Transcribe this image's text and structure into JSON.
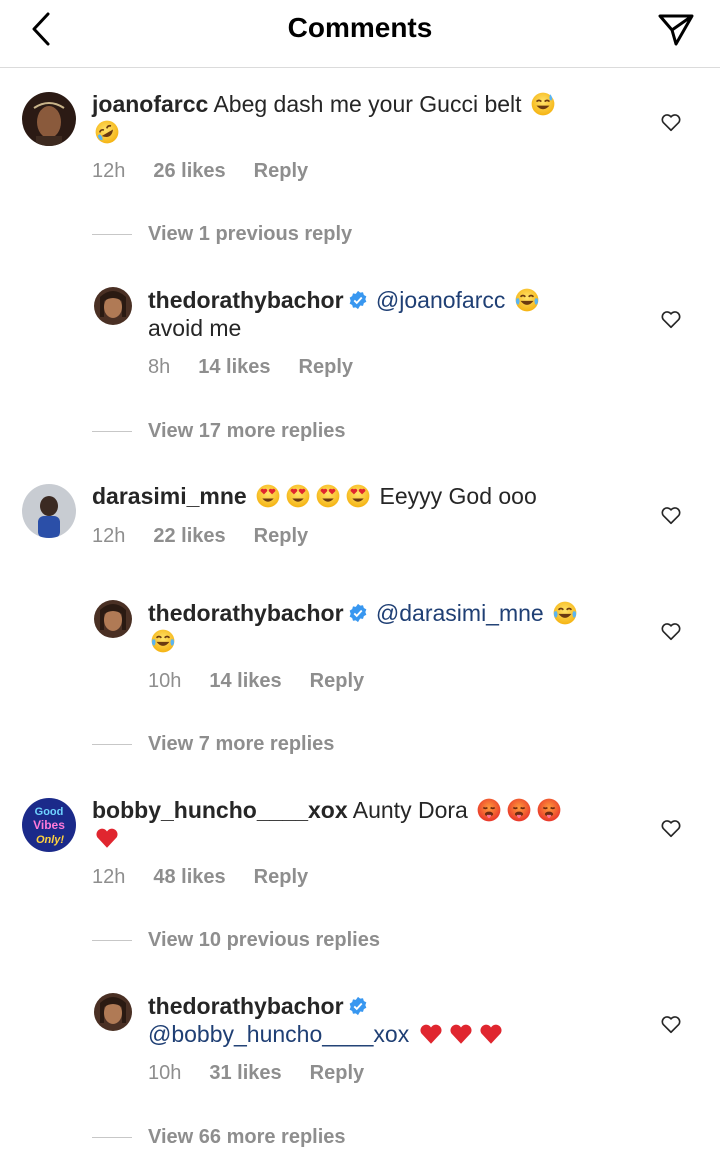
{
  "header": {
    "title": "Comments",
    "back_icon": "chevron-left-icon",
    "send_icon": "paper-plane-icon"
  },
  "colors": {
    "mention": "#1f3f74",
    "verified": "#3897f0",
    "meta": "#8e8e8e",
    "divider": "#dbdbdb",
    "heart_red": "#e0262f"
  },
  "comments": [
    {
      "username": "joanofarcc",
      "text": "Abeg dash me your Gucci belt",
      "emojis": [
        "grinning-sweat-emoji",
        "rofl-emoji"
      ],
      "time": "12h",
      "likes": "26 likes",
      "reply": "Reply"
    },
    {
      "view_link": "View 1 previous reply",
      "username": "thedorathybachor",
      "mention": "@joanofarcc",
      "text": "avoid me",
      "emojis": [
        "joy-emoji"
      ],
      "time": "8h",
      "likes": "14 likes",
      "reply": "Reply",
      "more_link": "View 17 more replies"
    },
    {
      "username": "darasimi_mne",
      "text": "Eeyyy God ooo",
      "emojis": [
        "heart-eyes-emoji",
        "heart-eyes-emoji",
        "heart-eyes-emoji",
        "heart-eyes-emoji"
      ],
      "time": "12h",
      "likes": "22 likes",
      "reply": "Reply"
    },
    {
      "username": "thedorathybachor",
      "mention": "@darasimi_mne",
      "text": "",
      "emojis": [
        "joy-emoji",
        "joy-emoji"
      ],
      "time": "10h",
      "likes": "14 likes",
      "reply": "Reply",
      "more_link": "View 7 more replies"
    },
    {
      "username": "bobby_huncho____xox",
      "text": "Aunty Dora",
      "avatar_text": [
        "Good",
        "Vibes",
        "Only!"
      ],
      "emojis": [
        "hot-face-emoji",
        "hot-face-emoji",
        "hot-face-emoji",
        "red-heart-emoji"
      ],
      "time": "12h",
      "likes": "48 likes",
      "reply": "Reply"
    },
    {
      "view_link": "View 10 previous replies",
      "username": "thedorathybachor",
      "mention": "@bobby_huncho____xox",
      "text": "",
      "emojis": [
        "red-heart-emoji",
        "red-heart-emoji",
        "red-heart-emoji"
      ],
      "time": "10h",
      "likes": "31 likes",
      "reply": "Reply",
      "more_link": "View 66 more replies"
    }
  ]
}
